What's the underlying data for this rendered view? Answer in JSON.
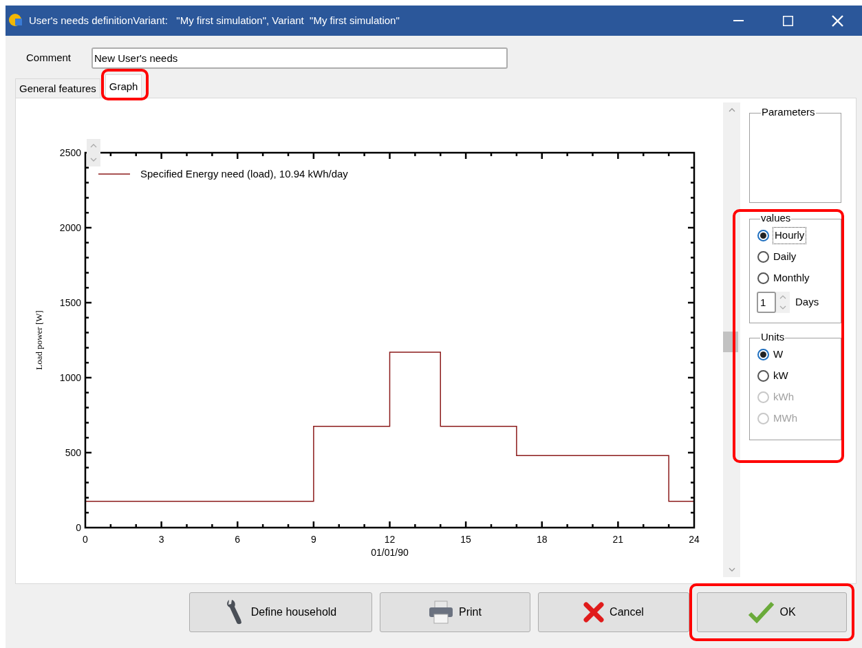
{
  "window": {
    "title": "User's needs definitionVariant:   \"My first simulation\", Variant  \"My first simulation\""
  },
  "comment": {
    "label": "Comment",
    "value": "New User's needs"
  },
  "tabs": [
    {
      "label": "General features",
      "selected": false,
      "highlighted": false
    },
    {
      "label": "Graph",
      "selected": true,
      "highlighted": true
    }
  ],
  "graph": {
    "chart_data": {
      "type": "line",
      "xlabel": "01/01/90",
      "ylabel": "Load power [W]",
      "x": [
        0,
        9,
        9,
        12,
        12,
        14,
        14,
        17,
        17,
        23,
        23,
        24
      ],
      "series": [
        {
          "name": "Specified Energy need (load),  10.94 kWh/day",
          "color": "#8b1a1a",
          "values": [
            175,
            175,
            675,
            675,
            1170,
            1170,
            675,
            675,
            480,
            480,
            175,
            175
          ]
        }
      ],
      "xlim": [
        0,
        24
      ],
      "ylim": [
        0,
        2500
      ],
      "xticks": [
        0,
        3,
        6,
        9,
        12,
        15,
        18,
        21,
        24
      ],
      "yticks": [
        0,
        500,
        1000,
        1500,
        2000,
        2500
      ]
    }
  },
  "options_panel": {
    "highlighted": true,
    "parameters": {
      "title": "Parameters"
    },
    "values": {
      "title": "values",
      "options": [
        {
          "label": "Hourly",
          "selected": true,
          "focused": true
        },
        {
          "label": "Daily",
          "selected": false,
          "focused": false
        },
        {
          "label": "Monthly",
          "selected": false,
          "focused": false
        }
      ],
      "days": {
        "value": "1",
        "label": "Days"
      }
    },
    "units": {
      "title": "Units",
      "options": [
        {
          "label": "W",
          "selected": true,
          "disabled": false
        },
        {
          "label": "kW",
          "selected": false,
          "disabled": false
        },
        {
          "label": "kWh",
          "selected": false,
          "disabled": true
        },
        {
          "label": "MWh",
          "selected": false,
          "disabled": true
        }
      ]
    }
  },
  "buttons": [
    {
      "kind": "household",
      "label": "Define household",
      "highlighted": false
    },
    {
      "kind": "print",
      "label": "Print",
      "highlighted": false
    },
    {
      "kind": "cancel",
      "label": "Cancel",
      "highlighted": false
    },
    {
      "kind": "ok",
      "label": "OK",
      "highlighted": true
    }
  ]
}
